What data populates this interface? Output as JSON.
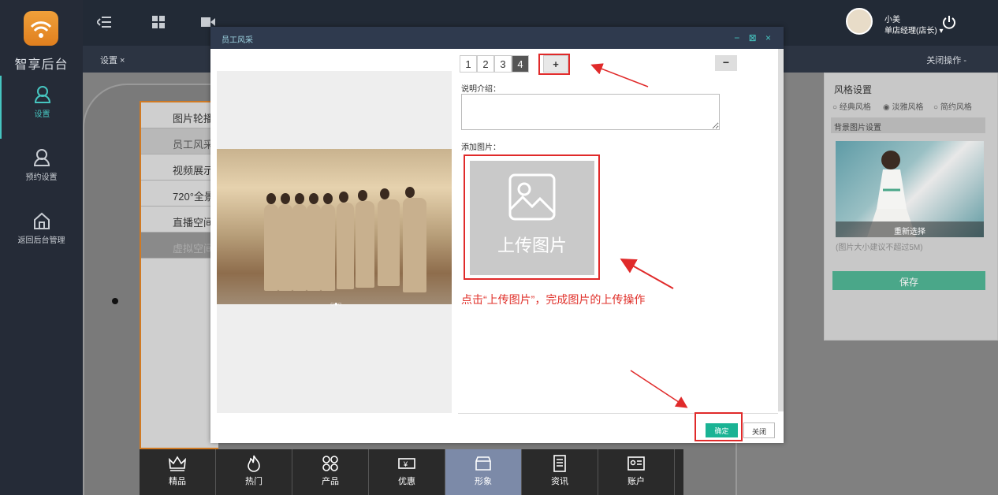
{
  "sidebar": {
    "brand": "智享后台",
    "items": [
      {
        "label": "设置",
        "icon": "user-icon"
      },
      {
        "label": "预约设置",
        "icon": "user-icon"
      },
      {
        "label": "返回后台管理",
        "icon": "home-icon"
      }
    ]
  },
  "header": {
    "tab_label": "设置 ×",
    "close_ops": "关闭操作 -",
    "user_name": "小美",
    "user_role": "单店经理(店长) ▾"
  },
  "menu_items": [
    "图片轮播",
    "员工风采",
    "视频展示",
    "720°全景",
    "直播空间",
    "虚拟空间"
  ],
  "bottom_nav": [
    "精品",
    "热门",
    "产品",
    "优惠",
    "形象",
    "资讯",
    "账户"
  ],
  "right_panel": {
    "style_title": "风格设置",
    "radios": [
      "经典风格",
      "淡雅风格",
      "简约风格"
    ],
    "selected_style": "淡雅风格",
    "bg_title": "背景图片设置",
    "reselect": "重新选择",
    "size_tip": "(图片大小建议不超过5M)",
    "save": "保存"
  },
  "modal": {
    "title": "员工风采",
    "controls": "− ⊠ ×",
    "tabs": [
      "1",
      "2",
      "3",
      "4"
    ],
    "active_tab": "4",
    "add_tab": "+",
    "remove_tab": "−",
    "desc_label": "说明介绍：",
    "add_image_label": "添加图片：",
    "upload_text": "上传图片",
    "hint": "点击“上传图片”，完成图片的上传操作",
    "confirm": "确定",
    "close": "关闭"
  },
  "colors": {
    "accent": "#1ab394",
    "highlight": "#e02a2a",
    "sidebar": "#252b37"
  }
}
